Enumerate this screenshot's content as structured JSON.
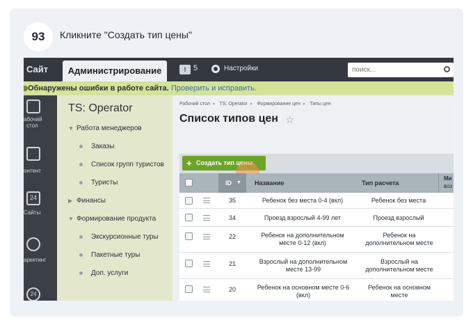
{
  "step": {
    "number": "93",
    "instruction": "Кликните \"Создать тип цены\""
  },
  "topbar": {
    "site_tab": "Сайт",
    "admin_tab": "Администрирование",
    "badge_count": "5",
    "settings_label": "Настройки",
    "search_placeholder": "поиск..."
  },
  "alert": {
    "text": "Обнаружены ошибки в работе сайта.",
    "link": "Проверить и исправить."
  },
  "iconbar": {
    "items": [
      {
        "label": "Рабочий стол",
        "icon": "home-icon"
      },
      {
        "label": "Контент",
        "icon": "document-icon"
      },
      {
        "label": "Сайты",
        "icon": "calendar-icon"
      },
      {
        "label": "Маркетинг",
        "icon": "target-icon"
      }
    ],
    "desktop_label_1": "абочий",
    "desktop_label_2": "стол",
    "content_label": "онтент",
    "sites_label": "Сайты",
    "sites_icon_text": "24",
    "marketing_label": "аркетинг",
    "bottom_icon_text": "24"
  },
  "sidemenu": {
    "title": "TS: Operator",
    "items": [
      {
        "label": "Работа менеджеров",
        "type": "expanded"
      },
      {
        "label": "Заказы",
        "type": "bullet"
      },
      {
        "label": "Список групп туристов",
        "type": "bullet"
      },
      {
        "label": "Туристы",
        "type": "bullet"
      },
      {
        "label": "Финансы",
        "type": "collapsed"
      },
      {
        "label": "Формирование продукта",
        "type": "expanded"
      },
      {
        "label": "Экскурсионные туры",
        "type": "bullet"
      },
      {
        "label": "Пакетные туры",
        "type": "bullet"
      },
      {
        "label": "Доп. услуги",
        "type": "bullet"
      }
    ]
  },
  "breadcrumb": [
    "Рабочий стол",
    "TS: Operator",
    "Формирование цен",
    "Типы цен"
  ],
  "page_title": "Список типов цен",
  "create_button": "Создать тип цены",
  "table": {
    "headers": {
      "id": "ID",
      "name": "Название",
      "calc": "Тип расчета",
      "extra_1": "Ми",
      "extra_2": "воз"
    },
    "rows": [
      {
        "id": "35",
        "name": "Ребенок без места 0-4 (вкл)",
        "calc": "Ребенок без места"
      },
      {
        "id": "34",
        "name": "Проезд взрослый 4-99 лет",
        "calc": "Проезд взрослый"
      },
      {
        "id": "22",
        "name": "Ребенок на дополнительном месте 0-12 (вкл)",
        "calc": "Ребенок на дополнительном месте"
      },
      {
        "id": "21",
        "name": "Взрослый на дополнительном месте 13-99",
        "calc": "Взрослый на дополнительном месте"
      },
      {
        "id": "20",
        "name": "Ребенок на основном месте 0-6 (вкл)",
        "calc": "Ребенок на основном месте"
      }
    ]
  },
  "colors": {
    "accent_green": "#6ea32a",
    "topbar": "#34393f",
    "alert_bg": "#d3e39a",
    "cursor": "#f39646"
  }
}
